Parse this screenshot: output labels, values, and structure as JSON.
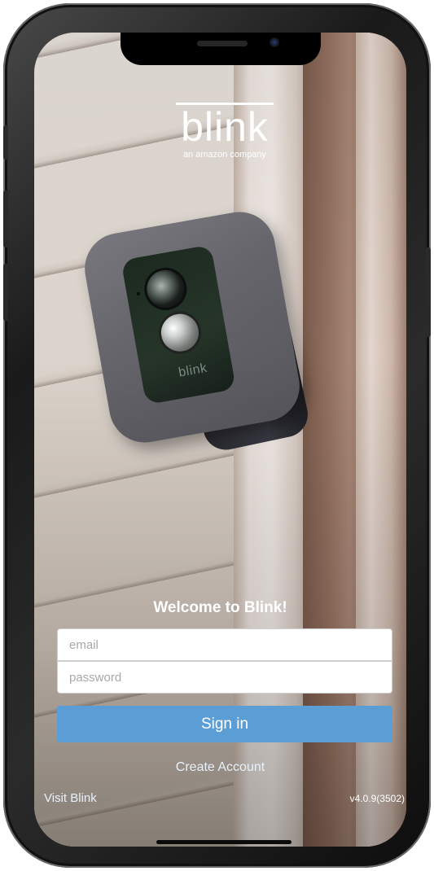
{
  "brand": {
    "wordmark": "blink",
    "tagline": "an amazon company"
  },
  "camera": {
    "logo_text": "blink"
  },
  "login": {
    "welcome": "Welcome to Blink!",
    "email_placeholder": "email",
    "password_placeholder": "password",
    "signin_label": "Sign in",
    "create_account_label": "Create Account"
  },
  "footer": {
    "visit_label": "Visit Blink",
    "version": "v4.0.9(3502)"
  },
  "colors": {
    "signin_button": "#5b9ed6",
    "text_white": "#ffffff"
  }
}
